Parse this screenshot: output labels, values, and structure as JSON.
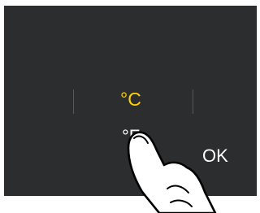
{
  "unit_picker": {
    "selected": "°C",
    "alternative": "°F"
  },
  "confirm": {
    "label": "OK"
  },
  "colors": {
    "screen_background": "#2b2d2f",
    "selected_unit": "#ffd200",
    "text": "#ffffff"
  },
  "overlay": {
    "icon": "tapping-hand-icon"
  }
}
